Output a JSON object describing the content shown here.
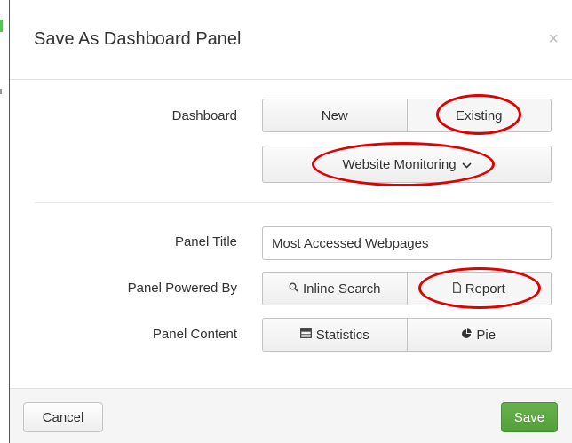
{
  "dialog": {
    "title": "Save As Dashboard Panel",
    "close_glyph": "×"
  },
  "dashboard": {
    "label": "Dashboard",
    "options": [
      "New",
      "Existing"
    ],
    "selected": "Existing",
    "dropdown_value": "Website Monitoring",
    "dropdown_icon": "chevron-down-icon"
  },
  "panel_title": {
    "label": "Panel Title",
    "value": "Most Accessed Webpages"
  },
  "panel_powered_by": {
    "label": "Panel Powered By",
    "options": [
      {
        "label": "Inline Search",
        "icon": "search-icon"
      },
      {
        "label": "Report",
        "icon": "document-icon"
      }
    ],
    "selected": "Report"
  },
  "panel_content": {
    "label": "Panel Content",
    "options": [
      {
        "label": "Statistics",
        "icon": "table-icon"
      },
      {
        "label": "Pie",
        "icon": "pie-chart-icon"
      }
    ]
  },
  "footer": {
    "cancel_label": "Cancel",
    "save_label": "Save"
  },
  "colors": {
    "save_green": "#5ca845",
    "annotation_red": "#e00000",
    "backdrop": "#4a4a4a"
  }
}
